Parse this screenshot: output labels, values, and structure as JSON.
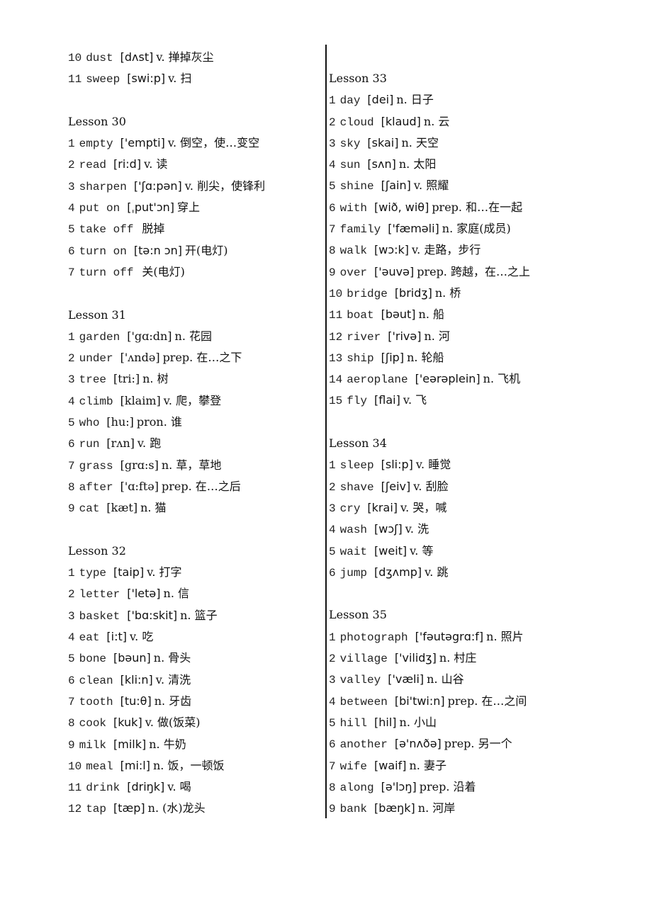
{
  "document": {
    "left_column": [
      {
        "type": "entry",
        "num": "10",
        "word": "dust",
        "ipa": "[dʌst]",
        "gloss": "v. 掸掉灰尘"
      },
      {
        "type": "entry",
        "num": "11",
        "word": "sweep",
        "ipa": "[swi:p]",
        "gloss": "v. 扫"
      },
      {
        "type": "gap"
      },
      {
        "type": "heading",
        "text": "Lesson 30"
      },
      {
        "type": "entry",
        "num": "1",
        "word": "empty",
        "ipa": "['empti]",
        "gloss": "v. 倒空，使…变空"
      },
      {
        "type": "entry",
        "num": "2",
        "word": "read",
        "ipa": "[ri:d]",
        "gloss": "v. 读"
      },
      {
        "type": "entry",
        "num": "3",
        "word": "sharpen",
        "ipa": "['ʃɑ:pən]",
        "gloss": "v. 削尖，使锋利"
      },
      {
        "type": "entry",
        "num": "4",
        "word": "put on",
        "ipa": "[ˌput'ɔn]",
        "gloss": "穿上"
      },
      {
        "type": "entry",
        "num": "5",
        "word": "take off",
        "ipa": "",
        "gloss": "脱掉"
      },
      {
        "type": "entry",
        "num": "6",
        "word": "turn on",
        "ipa": "[tə:n ɔn]",
        "gloss": "开(电灯)"
      },
      {
        "type": "entry",
        "num": "7",
        "word": "turn off",
        "ipa": "",
        "gloss": "关(电灯)"
      },
      {
        "type": "gap"
      },
      {
        "type": "heading",
        "text": "Lesson 31"
      },
      {
        "type": "entry",
        "num": "1",
        "word": "garden",
        "ipa": "['gɑ:dn]",
        "gloss": "n. 花园",
        "serif_ipa": true
      },
      {
        "type": "entry",
        "num": "2",
        "word": "under",
        "ipa": "['ʌndə]",
        "gloss": "prep. 在…之下",
        "serif_ipa": true
      },
      {
        "type": "entry",
        "num": "3",
        "word": "tree",
        "ipa": "[tri:]",
        "gloss": "n. 树",
        "serif_ipa": true
      },
      {
        "type": "entry",
        "num": "4",
        "word": "climb",
        "ipa": "[klaim]",
        "gloss": "v. 爬，攀登",
        "serif_ipa": true
      },
      {
        "type": "entry",
        "num": "5",
        "word": "who",
        "ipa": "[hu:]",
        "gloss": "pron. 谁",
        "serif_ipa": true
      },
      {
        "type": "entry",
        "num": "6",
        "word": "run",
        "ipa": "[rʌn]",
        "gloss": "v. 跑",
        "serif_ipa": true
      },
      {
        "type": "entry",
        "num": "7",
        "word": "grass",
        "ipa": "[grɑ:s]",
        "gloss": "n. 草，草地",
        "serif_ipa": true
      },
      {
        "type": "entry",
        "num": "8",
        "word": "after",
        "ipa": "['ɑ:ftə]",
        "gloss": "prep. 在…之后",
        "serif_ipa": true
      },
      {
        "type": "entry",
        "num": "9",
        "word": "cat",
        "ipa": "[kæt]",
        "gloss": "n. 猫",
        "serif_ipa": true
      },
      {
        "type": "gap"
      },
      {
        "type": "heading",
        "text": "Lesson 32"
      },
      {
        "type": "entry",
        "num": "1",
        "word": "type",
        "ipa": "[taip]",
        "gloss": "v. 打字"
      },
      {
        "type": "entry",
        "num": "2",
        "word": "letter",
        "ipa": "['letə]",
        "gloss": "n. 信"
      },
      {
        "type": "entry",
        "num": "3",
        "word": "basket",
        "ipa": "['bɑ:skit]",
        "gloss": "n. 篮子"
      },
      {
        "type": "entry",
        "num": "4",
        "word": "eat",
        "ipa": "[i:t]",
        "gloss": "v. 吃"
      },
      {
        "type": "entry",
        "num": "5",
        "word": "bone",
        "ipa": "[bəun]",
        "gloss": "n. 骨头"
      },
      {
        "type": "entry",
        "num": "6",
        "word": "clean",
        "ipa": "[kli:n]",
        "gloss": "v. 清洗"
      },
      {
        "type": "entry",
        "num": "7",
        "word": "tooth",
        "ipa": "[tu:θ]",
        "gloss": "n. 牙齿"
      },
      {
        "type": "entry",
        "num": "8",
        "word": "cook",
        "ipa": "[kuk]",
        "gloss": "v. 做(饭菜)"
      },
      {
        "type": "entry",
        "num": "9",
        "word": "milk",
        "ipa": "[milk]",
        "gloss": "n. 牛奶"
      },
      {
        "type": "entry",
        "num": "10",
        "word": "meal",
        "ipa": "[mi:l]",
        "gloss": "n. 饭，一顿饭"
      },
      {
        "type": "entry",
        "num": "11",
        "word": "drink",
        "ipa": "[driŋk]",
        "gloss": "v. 喝"
      },
      {
        "type": "entry",
        "num": "12",
        "word": "tap",
        "ipa": "[tæp]",
        "gloss": "n. (水)龙头"
      }
    ],
    "right_column": [
      {
        "type": "heading",
        "text": "Lesson 33"
      },
      {
        "type": "entry",
        "num": "1",
        "word": "day",
        "ipa": "[dei]",
        "gloss": "n. 日子"
      },
      {
        "type": "entry",
        "num": "2",
        "word": "cloud",
        "ipa": "[klaud]",
        "gloss": "n. 云"
      },
      {
        "type": "entry",
        "num": "3",
        "word": "sky",
        "ipa": "[skai]",
        "gloss": "n. 天空"
      },
      {
        "type": "entry",
        "num": "4",
        "word": "sun",
        "ipa": "[sʌn]",
        "gloss": "n. 太阳"
      },
      {
        "type": "entry",
        "num": "5",
        "word": "shine",
        "ipa": "[ʃain]",
        "gloss": "v. 照耀"
      },
      {
        "type": "entry",
        "num": "6",
        "word": "with",
        "ipa": "[wið, wiθ]",
        "gloss": "prep. 和…在一起"
      },
      {
        "type": "entry",
        "num": "7",
        "word": "family",
        "ipa": "['fæməli]",
        "gloss": "n. 家庭(成员)"
      },
      {
        "type": "entry",
        "num": "8",
        "word": "walk",
        "ipa": "[wɔ:k]",
        "gloss": "v. 走路，步行"
      },
      {
        "type": "entry",
        "num": "9",
        "word": "over",
        "ipa": "['əuvə]",
        "gloss": "prep. 跨越，在…之上"
      },
      {
        "type": "entry",
        "num": "10",
        "word": "bridge",
        "ipa": "[bridʒ]",
        "gloss": "n. 桥"
      },
      {
        "type": "entry",
        "num": "11",
        "word": "boat",
        "ipa": "[bəut]",
        "gloss": "n. 船"
      },
      {
        "type": "entry",
        "num": "12",
        "word": "river",
        "ipa": "['rivə]",
        "gloss": "n. 河"
      },
      {
        "type": "entry",
        "num": "13",
        "word": "ship",
        "ipa": "[ʃip]",
        "gloss": "n. 轮船"
      },
      {
        "type": "entry",
        "num": "14",
        "word": "aeroplane",
        "ipa": "['eərəplein]",
        "gloss": "n. 飞机"
      },
      {
        "type": "entry",
        "num": "15",
        "word": "fly",
        "ipa": "[flai]",
        "gloss": "v. 飞"
      },
      {
        "type": "gap"
      },
      {
        "type": "heading",
        "text": "Lesson 34"
      },
      {
        "type": "entry",
        "num": "1",
        "word": "sleep",
        "ipa": "[sli:p]",
        "gloss": "v. 睡觉"
      },
      {
        "type": "entry",
        "num": "2",
        "word": "shave",
        "ipa": "[ʃeiv]",
        "gloss": "v. 刮脸"
      },
      {
        "type": "entry",
        "num": "3",
        "word": "cry",
        "ipa": "[krai]",
        "gloss": "v. 哭，喊"
      },
      {
        "type": "entry",
        "num": "4",
        "word": "wash",
        "ipa": "[wɔʃ]",
        "gloss": "v. 洗"
      },
      {
        "type": "entry",
        "num": "5",
        "word": "wait",
        "ipa": "[weit]",
        "gloss": "v. 等"
      },
      {
        "type": "entry",
        "num": "6",
        "word": "jump",
        "ipa": "[dʒʌmp]",
        "gloss": "v. 跳"
      },
      {
        "type": "gap"
      },
      {
        "type": "heading",
        "text": "Lesson 35"
      },
      {
        "type": "entry",
        "num": "1",
        "word": "photograph",
        "ipa": "['fəutəgrɑ:f]",
        "gloss": "n. 照片"
      },
      {
        "type": "entry",
        "num": "2",
        "word": "village",
        "ipa": "['vilidʒ]",
        "gloss": "n. 村庄"
      },
      {
        "type": "entry",
        "num": "3",
        "word": "valley",
        "ipa": "['væli]",
        "gloss": "n. 山谷"
      },
      {
        "type": "entry",
        "num": "4",
        "word": "between",
        "ipa": "[bi'twi:n]",
        "gloss": "prep. 在…之间"
      },
      {
        "type": "entry",
        "num": "5",
        "word": "hill",
        "ipa": "[hil]",
        "gloss": "n. 小山"
      },
      {
        "type": "entry",
        "num": "6",
        "word": "another",
        "ipa": "[ə'nʌðə]",
        "gloss": "prep. 另一个"
      },
      {
        "type": "entry",
        "num": "7",
        "word": "wife",
        "ipa": "[waif]",
        "gloss": "n. 妻子"
      },
      {
        "type": "entry",
        "num": "8",
        "word": "along",
        "ipa": "[ə'lɔŋ]",
        "gloss": "prep. 沿着"
      },
      {
        "type": "entry",
        "num": "9",
        "word": "bank",
        "ipa": "[bæŋk]",
        "gloss": "n. 河岸"
      }
    ]
  }
}
